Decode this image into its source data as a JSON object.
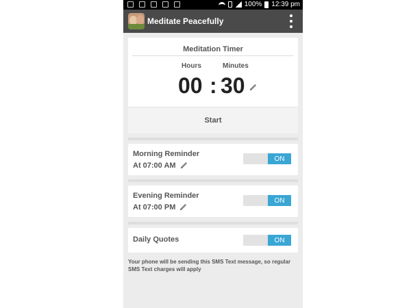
{
  "status_bar": {
    "battery_text": "100%",
    "time": "12:39 pm"
  },
  "app_bar": {
    "title": "Meditate Peacefully",
    "icons": {
      "app": "app-logo-icon",
      "menu": "overflow-menu-icon"
    }
  },
  "timer": {
    "title": "Meditation Timer",
    "hours_label": "Hours",
    "minutes_label": "Minutes",
    "hours": "00",
    "separator": ":",
    "minutes": "30",
    "start_label": "Start"
  },
  "reminders": [
    {
      "title": "Morning Reminder",
      "time": "At 07:00 AM",
      "toggle": "ON"
    },
    {
      "title": "Evening Reminder",
      "time": "At 07:00 PM",
      "toggle": "ON"
    }
  ],
  "daily_quotes": {
    "title": "Daily Quotes",
    "toggle": "ON"
  },
  "footnote": "Your phone will be sending this SMS Text message, so regular SMS Text charges will apply",
  "colors": {
    "app_bar": "#4a4a4a",
    "toggle_on": "#3aa6d4",
    "background": "#ececec"
  }
}
